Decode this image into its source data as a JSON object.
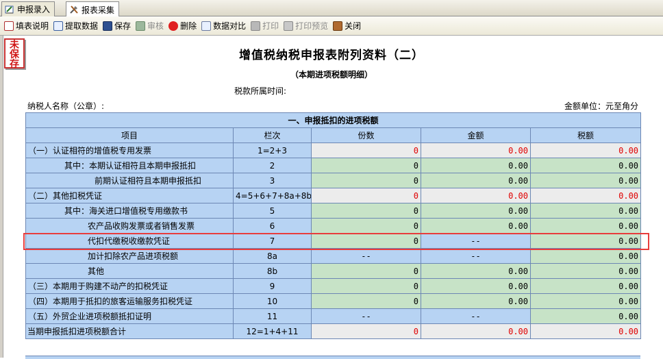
{
  "tabs": [
    {
      "label": "申报录入",
      "active": false
    },
    {
      "label": "报表采集",
      "active": true
    }
  ],
  "toolbar": {
    "fill_help": "填表说明",
    "fetch_data": "提取数据",
    "save": "保存",
    "review": "审核",
    "delete": "删除",
    "compare": "数据对比",
    "print": "打印",
    "print_preview": "打印预览",
    "close": "关闭"
  },
  "status": {
    "unsaved": "未保存"
  },
  "form": {
    "title": "增值税纳税申报表附列资料（二）",
    "subtitle": "（本期进项税额明细）",
    "period_label": "税款所属时间:",
    "taxpayer_label": "纳税人名称（公章）:",
    "unit_label": "金额单位：元至角分",
    "section1": "一、申报抵扣的进项税额",
    "headers": {
      "item": "项目",
      "line": "栏次",
      "count": "份数",
      "amount": "金额",
      "tax": "税额"
    },
    "rows": [
      {
        "item": "（一）认证相符的增值税专用发票",
        "line": "1=2+3",
        "count": "0",
        "amount": "0.00",
        "tax": "0.00"
      },
      {
        "item": "其中：本期认证相符且本期申报抵扣",
        "line": "2",
        "count": "0",
        "amount": "0.00",
        "tax": "0.00"
      },
      {
        "item": "前期认证相符且本期申报抵扣",
        "line": "3",
        "count": "0",
        "amount": "0.00",
        "tax": "0.00"
      },
      {
        "item": "（二）其他扣税凭证",
        "line": "4=5+6+7+8a+8b",
        "count": "0",
        "amount": "0.00",
        "tax": "0.00"
      },
      {
        "item": "其中：海关进口增值税专用缴款书",
        "line": "5",
        "count": "0",
        "amount": "0.00",
        "tax": "0.00"
      },
      {
        "item": "农产品收购发票或者销售发票",
        "line": "6",
        "count": "0",
        "amount": "0.00",
        "tax": "0.00"
      },
      {
        "item": "代扣代缴税收缴款凭证",
        "line": "7",
        "count": "0",
        "amount": "--",
        "tax": "0.00"
      },
      {
        "item": "加计扣除农产品进项税额",
        "line": "8a",
        "count": "--",
        "amount": "--",
        "tax": "0.00"
      },
      {
        "item": "其他",
        "line": "8b",
        "count": "0",
        "amount": "0.00",
        "tax": "0.00"
      },
      {
        "item": "（三）本期用于购建不动产的扣税凭证",
        "line": "9",
        "count": "0",
        "amount": "0.00",
        "tax": "0.00"
      },
      {
        "item": "（四）本期用于抵扣的旅客运输服务扣税凭证",
        "line": "10",
        "count": "0",
        "amount": "0.00",
        "tax": "0.00"
      },
      {
        "item": "（五）外贸企业进项税额抵扣证明",
        "line": "11",
        "count": "--",
        "amount": "--",
        "tax": "0.00"
      },
      {
        "item": "当期申报抵扣进项税额合计",
        "line": "12=1+4+11",
        "count": "0",
        "amount": "0.00",
        "tax": "0.00"
      }
    ]
  },
  "colors": {
    "header_blue": "#b7d3f3",
    "editable_green": "#c7e3c7",
    "computed_gray": "#ececec",
    "computed_text": "#e00000",
    "highlight": "#e83c3c"
  }
}
